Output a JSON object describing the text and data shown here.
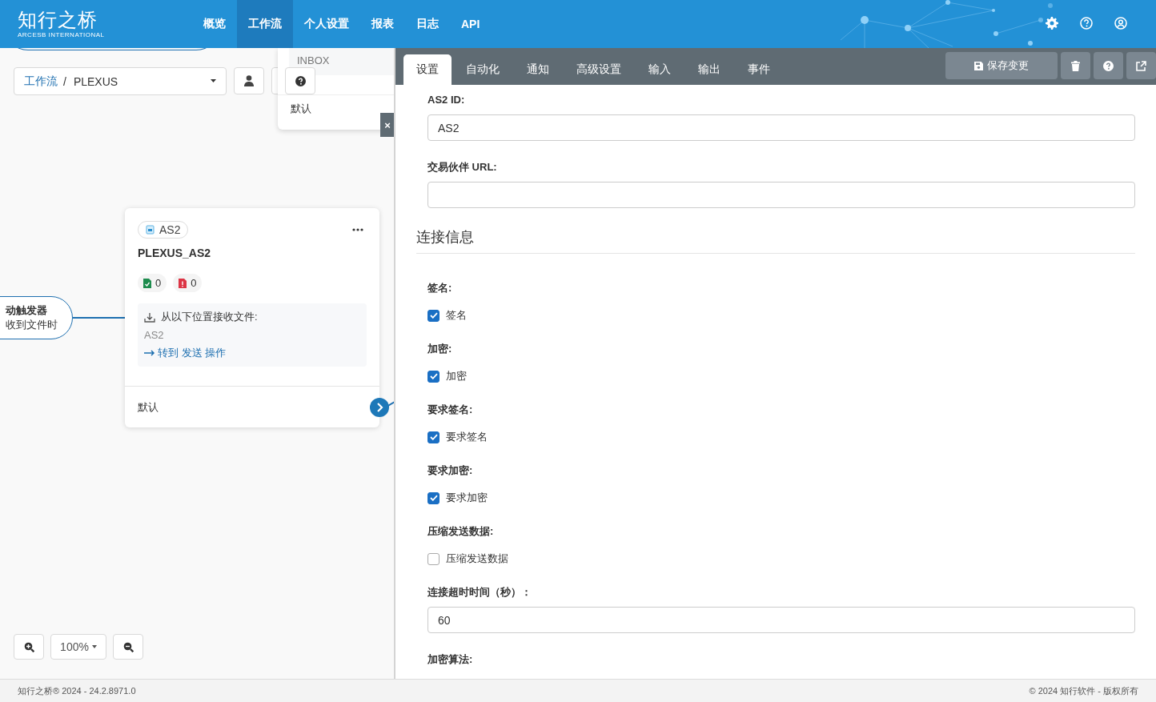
{
  "header": {
    "logo": {
      "title": "知行之桥",
      "subtitle": "ARCESB INTERNATIONAL"
    },
    "nav": [
      {
        "label": "概览",
        "selected": false
      },
      {
        "label": "工作流",
        "selected": true
      },
      {
        "label": "个人设置",
        "selected": false
      },
      {
        "label": "报表",
        "selected": false
      },
      {
        "label": "日志",
        "selected": false
      },
      {
        "label": "API",
        "selected": false
      }
    ]
  },
  "canvas": {
    "breadcrumb": {
      "root": "工作流",
      "separator": "/",
      "current": "PLEXUS"
    },
    "dropdown_menu": {
      "items": [
        {
          "label": "INBOX",
          "selected": true
        },
        {
          "label": "默认",
          "selected": false
        }
      ],
      "close": "×"
    },
    "trigger_node": {
      "title": "动触发器",
      "subtitle": "收到文件时"
    },
    "node": {
      "badge": "AS2",
      "name": "PLEXUS_AS2",
      "success_count": "0",
      "error_count": "0",
      "receive_label": "从以下位置接收文件:",
      "receive_source": "AS2",
      "goto_link": "转到 发送 操作",
      "output_label": "默认"
    },
    "zoom": {
      "level": "100%"
    }
  },
  "panel": {
    "tabs": [
      {
        "label": "设置",
        "selected": true
      },
      {
        "label": "自动化",
        "selected": false
      },
      {
        "label": "通知",
        "selected": false
      },
      {
        "label": "高级设置",
        "selected": false
      },
      {
        "label": "输入",
        "selected": false
      },
      {
        "label": "输出",
        "selected": false
      },
      {
        "label": "事件",
        "selected": false
      }
    ],
    "save_button": "保存变更",
    "form": [
      {
        "kind": "text",
        "label": "AS2 ID:",
        "value": "AS2"
      },
      {
        "kind": "text",
        "label": "交易伙伴 URL:"
      },
      {
        "kind": "heading",
        "label": "连接信息"
      },
      {
        "kind": "checkbox",
        "label": "签名:",
        "option": "签名",
        "checked": true
      },
      {
        "kind": "checkbox",
        "label": "加密:",
        "option": "加密",
        "checked": true
      },
      {
        "kind": "checkbox",
        "label": "要求签名:",
        "option": "要求签名",
        "checked": true
      },
      {
        "kind": "checkbox",
        "label": "要求加密:",
        "option": "要求加密",
        "checked": true
      },
      {
        "kind": "checkbox",
        "label": "压缩发送数据:",
        "option": "压缩发送数据",
        "checked": false
      },
      {
        "kind": "text",
        "label": "连接超时时间（秒）：",
        "value": "60"
      },
      {
        "kind": "label",
        "label": "加密算法:"
      }
    ]
  },
  "footer": {
    "left": "知行之桥® 2024 - 24.2.8971.0",
    "right": "© 2024 知行软件 - 版权所有"
  }
}
